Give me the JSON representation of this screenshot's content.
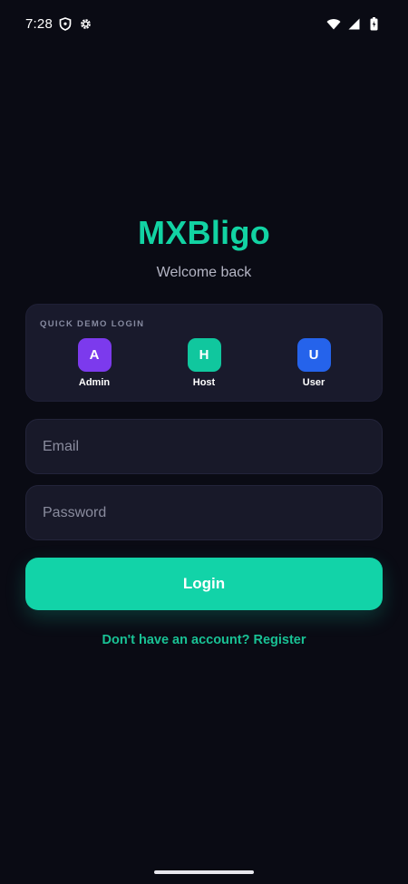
{
  "status_bar": {
    "time": "7:28",
    "icons_left": [
      "shield-icon",
      "gear-icon"
    ],
    "icons_right": [
      "wifi-icon",
      "signal-icon",
      "battery-icon"
    ]
  },
  "header": {
    "app_name": "MXBligo",
    "subtitle": "Welcome back"
  },
  "quick_demo": {
    "heading": "QUICK DEMO LOGIN",
    "options": [
      {
        "initial": "A",
        "label": "Admin",
        "color": "#7c3aed"
      },
      {
        "initial": "H",
        "label": "Host",
        "color": "#10c79e"
      },
      {
        "initial": "U",
        "label": "User",
        "color": "#2563eb"
      }
    ]
  },
  "form": {
    "email_placeholder": "Email",
    "email_value": "",
    "password_placeholder": "Password",
    "password_value": "",
    "login_label": "Login",
    "register_text": "Don't have an account? Register"
  },
  "theme": {
    "background": "#0a0b14",
    "accent": "#12d3a8",
    "card": "#191a2c"
  }
}
